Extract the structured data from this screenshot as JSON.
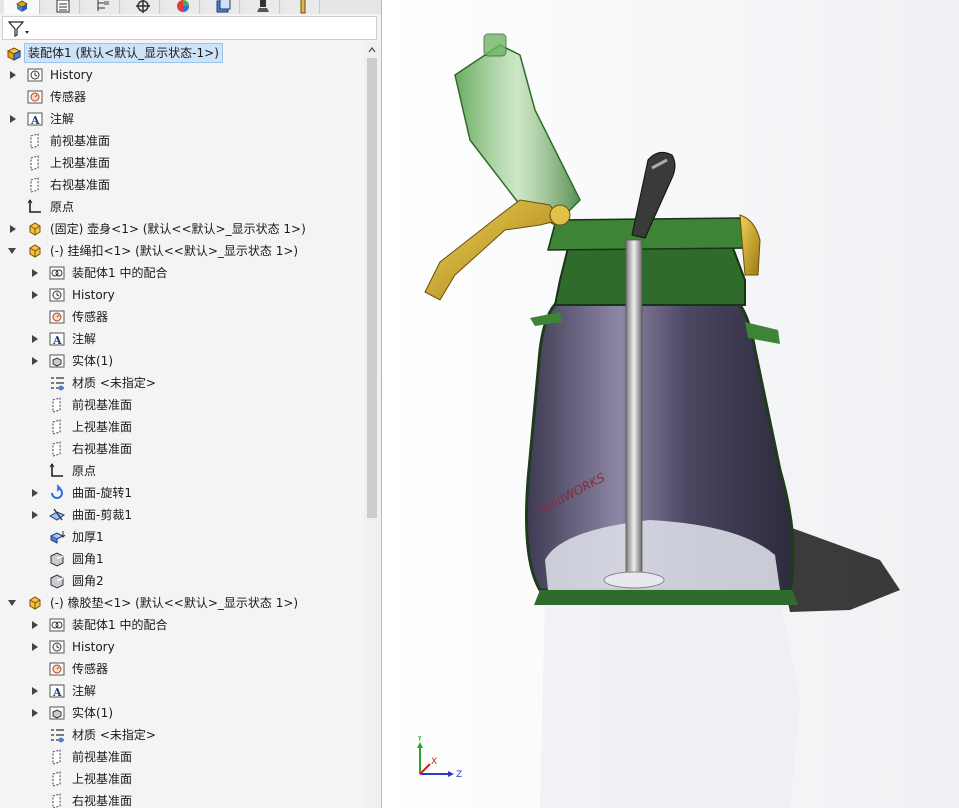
{
  "feature_tree": {
    "root": "装配体1  (默认<默认_显示状态-1>)",
    "items": [
      {
        "label": "History",
        "icon": "history-icon",
        "expand": true
      },
      {
        "label": "传感器",
        "icon": "sensor-icon",
        "expand": false
      },
      {
        "label": "注解",
        "icon": "annotation-icon",
        "expand": true
      },
      {
        "label": "前视基准面",
        "icon": "plane-icon",
        "expand": false
      },
      {
        "label": "上视基准面",
        "icon": "plane-icon",
        "expand": false
      },
      {
        "label": "右视基准面",
        "icon": "plane-icon",
        "expand": false
      },
      {
        "label": "原点",
        "icon": "origin-icon",
        "expand": false
      },
      {
        "label": "(固定) 壶身<1> (默认<<默认>_显示状态 1>)",
        "icon": "part-icon",
        "expand": true
      },
      {
        "label": "(-) 挂绳扣<1> (默认<<默认>_显示状态 1>)",
        "icon": "part-icon",
        "expand": true,
        "expanded": true
      },
      {
        "label": "装配体1 中的配合",
        "icon": "mates-icon",
        "expand": true
      },
      {
        "label": "History",
        "icon": "history-icon",
        "expand": true
      },
      {
        "label": "传感器",
        "icon": "sensor-icon",
        "expand": false
      },
      {
        "label": "注解",
        "icon": "annotation-icon",
        "expand": true
      },
      {
        "label": "实体(1)",
        "icon": "solid-bodies-icon",
        "expand": true
      },
      {
        "label": "材质 <未指定>",
        "icon": "material-icon",
        "expand": false
      },
      {
        "label": "前视基准面",
        "icon": "plane-icon",
        "expand": false
      },
      {
        "label": "上视基准面",
        "icon": "plane-icon",
        "expand": false
      },
      {
        "label": "右视基准面",
        "icon": "plane-icon",
        "expand": false
      },
      {
        "label": "原点",
        "icon": "origin-icon",
        "expand": false
      },
      {
        "label": "曲面-旋转1",
        "icon": "surface-revolve-icon",
        "expand": true
      },
      {
        "label": "曲面-剪裁1",
        "icon": "surface-trim-icon",
        "expand": true
      },
      {
        "label": "加厚1",
        "icon": "thicken-icon",
        "expand": false
      },
      {
        "label": "圆角1",
        "icon": "fillet-icon",
        "expand": false
      },
      {
        "label": "圆角2",
        "icon": "fillet-icon",
        "expand": false
      },
      {
        "label": "(-) 橡胶垫<1> (默认<<默认>_显示状态 1>)",
        "icon": "part-icon",
        "expand": true,
        "expanded": true
      },
      {
        "label": "装配体1 中的配合",
        "icon": "mates-icon",
        "expand": true
      },
      {
        "label": "History",
        "icon": "history-icon",
        "expand": true
      },
      {
        "label": "传感器",
        "icon": "sensor-icon",
        "expand": false
      },
      {
        "label": "注解",
        "icon": "annotation-icon",
        "expand": true
      },
      {
        "label": "实体(1)",
        "icon": "solid-bodies-icon",
        "expand": true
      },
      {
        "label": "材质 <未指定>",
        "icon": "material-icon",
        "expand": false
      },
      {
        "label": "前视基准面",
        "icon": "plane-icon",
        "expand": false
      },
      {
        "label": "上视基准面",
        "icon": "plane-icon",
        "expand": false
      },
      {
        "label": "右视基准面",
        "icon": "plane-icon",
        "expand": false
      }
    ]
  },
  "panel_tabs": [
    "feature-manager-tab",
    "property-manager-tab",
    "configuration-manager-tab",
    "dimxpert-tab",
    "display-manager-tab",
    "appearance-tab",
    "cam-tab",
    "tolerance-tab"
  ],
  "filter_icon": "filter-icon",
  "model": {
    "watermark": "SolidWORKS",
    "colors": {
      "green": "#2f6b2a",
      "translucent_green": "#5fae55",
      "gold": "#c9a21e",
      "purple": "#5a5470",
      "silver": "#b5b5b5"
    }
  },
  "triad": {
    "y": "Y",
    "z": "Z",
    "x": "X"
  }
}
